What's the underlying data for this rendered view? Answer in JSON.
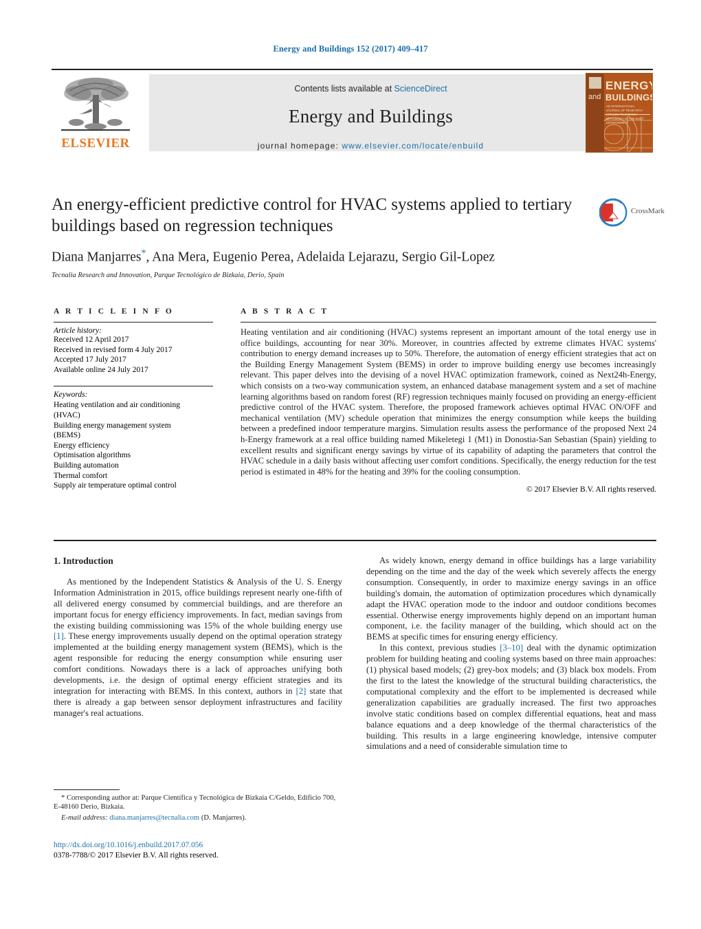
{
  "running_head": "Energy and Buildings 152 (2017) 409–417",
  "masthead": {
    "publisher": "ELSEVIER",
    "contents_prefix": "Contents lists available at ",
    "contents_link": "ScienceDirect",
    "journal_title": "Energy and Buildings",
    "homepage_prefix": "journal homepage: ",
    "homepage_url": "www.elsevier.com/locate/enbuild",
    "cover": {
      "line1": "ENERGY",
      "line_and": "and",
      "line2": "BUILDINGS",
      "subtitle": "AN INTERNATIONAL JOURNAL OF RESEARCH APPLIED TO ENERGY EFFICIENCY IN THE BUILT ENVIRONMENT"
    }
  },
  "article": {
    "title": "An energy-efficient predictive control for HVAC systems applied to tertiary buildings based on regression techniques",
    "authors": "Diana Manjarres",
    "authors_rest": ", Ana Mera, Eugenio Perea, Adelaida Lejarazu, Sergio Gil-Lopez",
    "corresponding_marker": "*",
    "affiliation": "Tecnalia Research and Innovation, Parque Tecnológico de Bizkaia, Derio, Spain",
    "crossmark_label": "CrossMark"
  },
  "article_info": {
    "heading": "A R T I C L E    I N F O",
    "history_label": "Article history:",
    "history": [
      "Received 12 April 2017",
      "Received in revised form 4 July 2017",
      "Accepted 17 July 2017",
      "Available online 24 July 2017"
    ],
    "keywords_label": "Keywords:",
    "keywords": [
      "Heating ventilation and air conditioning",
      "(HVAC)",
      "Building energy management system",
      "(BEMS)",
      "Energy efficiency",
      "Optimisation algorithms",
      "Building automation",
      "Thermal comfort",
      "Supply air temperature optimal control"
    ]
  },
  "abstract": {
    "heading": "A B S T R A C T",
    "text": "Heating ventilation and air conditioning (HVAC) systems represent an important amount of the total energy use in office buildings, accounting for near 30%. Moreover, in countries affected by extreme climates HVAC systems' contribution to energy demand increases up to 50%. Therefore, the automation of energy efficient strategies that act on the Building Energy Management System (BEMS) in order to improve building energy use becomes increasingly relevant. This paper delves into the devising of a novel HVAC optimization framework, coined as Next24h-Energy, which consists on a two-way communication system, an enhanced database management system and a set of machine learning algorithms based on random forest (RF) regression techniques mainly focused on providing an energy-efficient predictive control of the HVAC system. Therefore, the proposed framework achieves optimal HVAC ON/OFF and mechanical ventilation (MV) schedule operation that minimizes the energy consumption while keeps the building between a predefined indoor temperature margins. Simulation results assess the performance of the proposed Next 24 h-Energy framework at a real office building named Mikeletegi 1 (M1) in Donostia-San Sebastian (Spain) yielding to excellent results and significant energy savings by virtue of its capability of adapting the parameters that control the HVAC schedule in a daily basis without affecting user comfort conditions. Specifically, the energy reduction for the test period is estimated in 48% for the heating and 39% for the cooling consumption.",
    "copyright": "© 2017 Elsevier B.V. All rights reserved."
  },
  "body": {
    "section_heading": "1.  Introduction",
    "left_p1_a": "As mentioned by the Independent Statistics & Analysis of the U. S. Energy Information Administration in 2015, office buildings represent nearly one-fifth of all delivered energy consumed by commercial buildings, and are therefore an important focus for energy efficiency improvements. In fact, median savings from the existing building commissioning was 15% of the whole building energy use ",
    "left_p1_ref1": "[1]",
    "left_p1_b": ". These energy improvements usually depend on the optimal operation strategy implemented at the building energy management system (BEMS), which is the agent responsible for reducing the energy consumption while ensuring user comfort conditions. Nowadays there is a lack of approaches unifying both developments, i.e. the design of optimal energy efficient strategies and its integration for interacting with BEMS. In this context, authors in ",
    "left_p1_ref2": "[2]",
    "left_p1_c": " state that there is already a gap between sensor deployment infrastructures and facility manager's real actuations.",
    "right_p1": "As widely known, energy demand in office buildings has a large variability depending on the time and the day of the week which severely affects the energy consumption. Consequently, in order to maximize energy savings in an office building's domain, the automation of optimization procedures which dynamically adapt the HVAC operation mode to the indoor and outdoor conditions becomes essential. Otherwise energy improvements highly depend on an important human component, i.e. the facility manager of the building, which should act on the BEMS at specific times for ensuring energy efficiency.",
    "right_p2_a": "In this context, previous studies ",
    "right_p2_ref": "[3–10]",
    "right_p2_b": " deal with the dynamic optimization problem for building heating and cooling systems based on three main approaches: (1) physical based models; (2) grey-box models; and (3) black box models. From the first to the latest the knowledge of the structural building characteristics, the computational complexity and the effort to be implemented is decreased while generalization capabilities are gradually increased. The first two approaches involve static conditions based on complex differential equations, heat and mass balance equations and a deep knowledge of the thermal characteristics of the building. This results in a large engineering knowledge, intensive computer simulations and a need of considerable simulation time to"
  },
  "footnote": {
    "corr_marker": "*",
    "corr_text": " Corresponding author at: Parque Científica y Tecnológica de Bizkaia C/Geldo, Edificio 700, E-48160 Derio, Bizkaia.",
    "email_label": "E-mail address:",
    "email": "diana.manjarres@tecnalia.com",
    "email_attrib": " (D. Manjarres).",
    "doi_url": "http://dx.doi.org/10.1016/j.enbuild.2017.07.056",
    "issn_line": "0378-7788/© 2017 Elsevier B.V. All rights reserved."
  },
  "colors": {
    "link": "#1a6ea8",
    "elsevier_orange": "#e87722",
    "text": "#231f20",
    "band_gray": "#e8e8e8",
    "cover_orange": "#b5561c"
  }
}
